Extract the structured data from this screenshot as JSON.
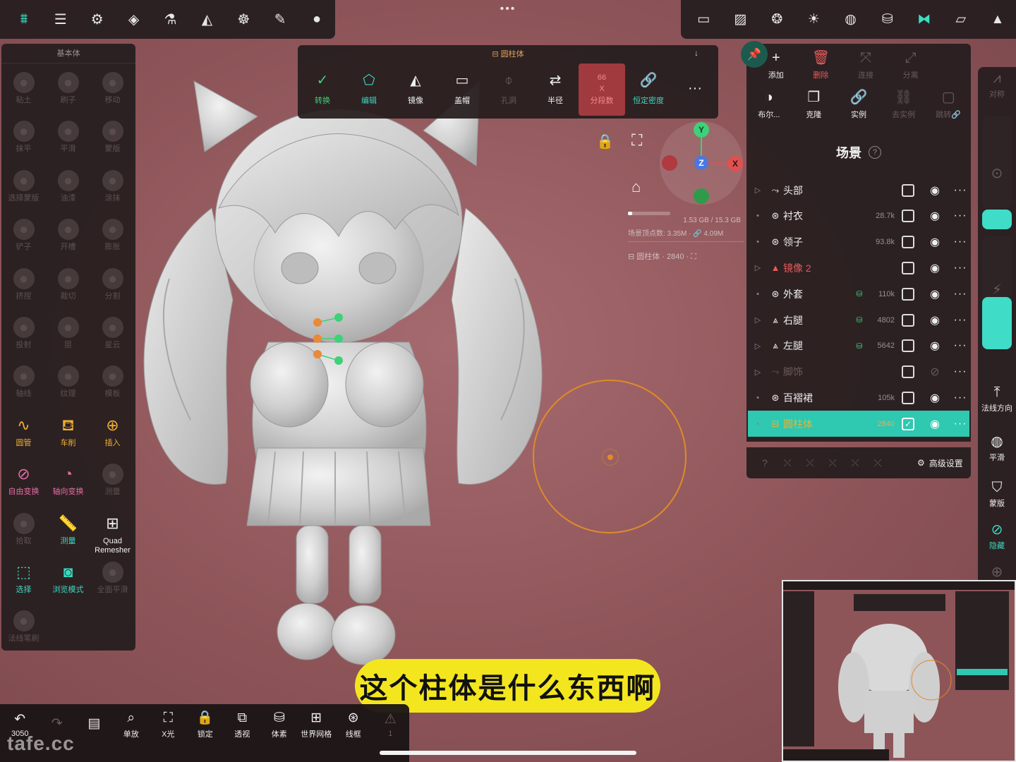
{
  "top_left_tools": [
    {
      "icon": "layers-stack-icon",
      "active": true
    },
    {
      "icon": "sliders-icon"
    },
    {
      "icon": "gear-icon"
    },
    {
      "icon": "stacked-layers-icon"
    },
    {
      "icon": "flask-icon"
    },
    {
      "icon": "symmetry-icon"
    },
    {
      "icon": "palette-icon"
    },
    {
      "icon": "pen-icon"
    },
    {
      "icon": "material-sphere-icon"
    }
  ],
  "top_right_tools": [
    {
      "icon": "camera-icon"
    },
    {
      "icon": "image-icon"
    },
    {
      "icon": "aperture-icon"
    },
    {
      "icon": "sun-icon"
    },
    {
      "icon": "globe-grid-icon"
    },
    {
      "icon": "cylinder-db-icon"
    },
    {
      "icon": "scene-graph-icon",
      "active": true
    },
    {
      "icon": "folder-icon"
    },
    {
      "icon": "nomad-logo-icon"
    }
  ],
  "top_dots": "•••",
  "left_panel": {
    "title": "基本体",
    "tools": [
      {
        "label": "粘土",
        "state": "dim",
        "icon": "clay-icon"
      },
      {
        "label": "刷子",
        "state": "dim",
        "icon": "brush-icon"
      },
      {
        "label": "移动",
        "state": "dim",
        "icon": "move-icon"
      },
      {
        "label": "抹平",
        "state": "dim",
        "icon": "flatten-icon"
      },
      {
        "label": "平滑",
        "state": "dim",
        "icon": "smooth-icon"
      },
      {
        "label": "蒙版",
        "state": "dim",
        "icon": "mask-icon"
      },
      {
        "label": "选择蒙版",
        "state": "dim",
        "icon": "select-mask-icon"
      },
      {
        "label": "油漆",
        "state": "dim",
        "icon": "paint-icon"
      },
      {
        "label": "涂抹",
        "state": "dim",
        "icon": "smudge-icon"
      },
      {
        "label": "铲子",
        "state": "dim",
        "icon": "scoop-icon"
      },
      {
        "label": "开槽",
        "state": "dim",
        "icon": "groove-icon"
      },
      {
        "label": "膨胀",
        "state": "dim",
        "icon": "inflate-icon"
      },
      {
        "label": "挤捏",
        "state": "dim",
        "icon": "pinch-icon"
      },
      {
        "label": "裁切",
        "state": "dim",
        "icon": "crop-icon"
      },
      {
        "label": "分割",
        "state": "dim",
        "icon": "split-icon"
      },
      {
        "label": "投射",
        "state": "dim",
        "icon": "project-icon"
      },
      {
        "label": "层",
        "state": "dim",
        "icon": "layer-icon"
      },
      {
        "label": "星云",
        "state": "dim",
        "icon": "nebula-icon"
      },
      {
        "label": "轴线",
        "state": "dim",
        "icon": "axis-icon"
      },
      {
        "label": "纹理",
        "state": "dim",
        "icon": "texture-icon"
      },
      {
        "label": "模板",
        "state": "dim",
        "icon": "stencil-icon"
      },
      {
        "label": "圆管",
        "state": "on",
        "color": "orange",
        "icon": "tube-curve-icon"
      },
      {
        "label": "车削",
        "state": "on",
        "color": "orange",
        "icon": "lathe-icon"
      },
      {
        "label": "插入",
        "state": "on",
        "color": "orange",
        "icon": "insert-icon"
      },
      {
        "label": "自由变换",
        "state": "on",
        "color": "pink",
        "icon": "free-transform-icon"
      },
      {
        "label": "轴向变换",
        "state": "on",
        "color": "pink",
        "icon": "axis-transform-icon"
      },
      {
        "label": "测量",
        "state": "dim",
        "icon": "measure-dim-icon"
      },
      {
        "label": "拾取",
        "state": "dim",
        "icon": "pick-icon"
      },
      {
        "label": "测量",
        "state": "on",
        "color": "teal",
        "icon": "ruler-icon"
      },
      {
        "label": "Quad Remesher",
        "state": "on",
        "color": "white",
        "icon": "grid-icon"
      },
      {
        "label": "选择",
        "state": "on",
        "color": "teal",
        "icon": "select-icon"
      },
      {
        "label": "浏览模式",
        "state": "on",
        "color": "teal",
        "icon": "camera-view-icon"
      },
      {
        "label": "全面平滑",
        "state": "dim",
        "icon": "full-smooth-icon"
      },
      {
        "label": "法线笔刷",
        "state": "dim",
        "icon": "normal-brush-icon"
      }
    ]
  },
  "cylinder_panel": {
    "title": "⊟ 圆柱体",
    "arrow": "↓",
    "tools": [
      {
        "label": "转换",
        "icon": "check-circle-icon",
        "color": "green",
        "glyph": "✓"
      },
      {
        "label": "编辑",
        "icon": "edit-shape-icon",
        "color": "teal",
        "glyph": "⬠"
      },
      {
        "label": "镜像",
        "icon": "mirror-icon",
        "color": "white",
        "glyph": "◭"
      },
      {
        "label": "盖帽",
        "icon": "cap-icon",
        "color": "white",
        "glyph": "▭"
      },
      {
        "label": "孔洞",
        "icon": "hole-icon",
        "color": "dim",
        "glyph": "⌽"
      },
      {
        "label": "半径",
        "icon": "radius-icon",
        "color": "white",
        "glyph": "⇄"
      },
      {
        "label": "分段数",
        "icon": "segments-icon",
        "color": "red",
        "value_a": "66",
        "value_b": "X"
      },
      {
        "label": "恒定密度",
        "icon": "link-icon",
        "color": "teal",
        "glyph": "🔗"
      },
      {
        "label": "",
        "icon": "more-icon",
        "color": "white",
        "glyph": "···"
      }
    ]
  },
  "viewport": {
    "memory": "1.53 GB / 15.3 GB",
    "scene_vertices": "场景顶点数: 3.35M · 🔗 4.09M",
    "object_info": "⊟ 圆柱体 · 2840 · ⛶",
    "gizmo": {
      "y": "Y",
      "z": "Z",
      "x": "X"
    }
  },
  "scene_actions": {
    "row1": [
      {
        "label": "添加",
        "icon": "plus-icon",
        "glyph": "+"
      },
      {
        "label": "删除",
        "icon": "trash-icon",
        "glyph": "🗑",
        "color": "red"
      },
      {
        "label": "连接",
        "icon": "join-icon",
        "glyph": "⤧",
        "color": "dim"
      },
      {
        "label": "分离",
        "icon": "separate-icon",
        "glyph": "⤢",
        "color": "dim"
      }
    ],
    "row2": [
      {
        "label": "布尔...",
        "icon": "boolean-icon",
        "glyph": "◑"
      },
      {
        "label": "克隆",
        "icon": "clone-icon",
        "glyph": "❐"
      },
      {
        "label": "实例",
        "icon": "instance-link-icon",
        "glyph": "🔗"
      },
      {
        "label": "去实例",
        "icon": "uninstance-icon",
        "glyph": "⛓",
        "color": "dim"
      },
      {
        "label": "跳转🔗",
        "icon": "jump-icon",
        "glyph": "▢",
        "color": "dim"
      }
    ]
  },
  "scene": {
    "title": "场景",
    "help": "?",
    "items": [
      {
        "name": "头部",
        "type": "group",
        "expand": "▷",
        "type_glyph": "⤳",
        "count": "",
        "locked": false,
        "checked": false,
        "visible": true
      },
      {
        "name": "衬衣",
        "type": "mesh",
        "expand": "•",
        "type_glyph": "⊛",
        "count": "28.7k",
        "locked": false,
        "checked": false,
        "visible": true
      },
      {
        "name": "领子",
        "type": "mesh",
        "expand": "•",
        "type_glyph": "⊛",
        "count": "93.8k",
        "locked": false,
        "checked": false,
        "visible": true
      },
      {
        "name": "镜像 2",
        "type": "mirror",
        "expand": "▷",
        "type_glyph": "▲",
        "count": "",
        "locked": false,
        "checked": false,
        "visible": true,
        "color": "red"
      },
      {
        "name": "外套",
        "type": "mesh",
        "expand": "•",
        "type_glyph": "⊛",
        "count": "110k",
        "locked": true,
        "checked": false,
        "visible": true
      },
      {
        "name": "右腿",
        "type": "mesh-group",
        "expand": "▷",
        "type_glyph": "⩓",
        "count": "4802",
        "locked": true,
        "checked": false,
        "visible": true
      },
      {
        "name": "左腿",
        "type": "mesh-group",
        "expand": "▷",
        "type_glyph": "⩓",
        "count": "5642",
        "locked": true,
        "checked": false,
        "visible": true
      },
      {
        "name": "脚饰",
        "type": "group",
        "expand": "▷",
        "type_glyph": "⤳",
        "count": "",
        "locked": false,
        "checked": false,
        "visible": false,
        "color": "dim"
      },
      {
        "name": "百褶裙",
        "type": "mesh",
        "expand": "•",
        "type_glyph": "⊛",
        "count": "105k",
        "locked": false,
        "checked": false,
        "visible": true
      },
      {
        "name": "圆柱体",
        "type": "cylinder",
        "expand": "•",
        "type_glyph": "⊟",
        "count": "2840",
        "locked": false,
        "checked": true,
        "visible": true,
        "selected": true
      }
    ],
    "footer_advanced": "高级设置"
  },
  "right_panel": [
    {
      "label": "对称",
      "icon": "symmetry-side-icon",
      "glyph": "⩘",
      "color": "dim"
    },
    {
      "label": "",
      "icon": "target-icon",
      "glyph": "⊙",
      "color": "dim"
    },
    {
      "label": "",
      "icon": "bolt-icon",
      "glyph": "⚡",
      "color": "dim"
    },
    {
      "label": "法线方向",
      "icon": "upload-icon",
      "glyph": "⤒"
    },
    {
      "label": "平滑",
      "icon": "smooth-sphere-icon",
      "glyph": "◍"
    },
    {
      "label": "蒙版",
      "icon": "mask-shield-icon",
      "glyph": "⛉"
    },
    {
      "label": "隐藏",
      "icon": "hide-icon",
      "glyph": "⊘",
      "color": "teal"
    },
    {
      "label": "",
      "icon": "axis-gizmo-icon",
      "glyph": "⊕",
      "color": "dim"
    }
  ],
  "subtitle": "这个柱体是什么东西啊",
  "bottom_tools": [
    {
      "label": "3050",
      "icon": "undo-icon",
      "glyph": "↶"
    },
    {
      "label": "",
      "icon": "redo-icon",
      "glyph": "↷",
      "color": "dim"
    },
    {
      "label": "",
      "icon": "document-icon",
      "glyph": "▤"
    },
    {
      "label": "单放",
      "icon": "search-icon",
      "glyph": "⌕"
    },
    {
      "label": "X光",
      "icon": "xray-icon",
      "glyph": "⛶"
    },
    {
      "label": "锁定",
      "icon": "lock-icon",
      "glyph": "🔒"
    },
    {
      "label": "透视",
      "icon": "perspective-icon",
      "glyph": "⧉"
    },
    {
      "label": "体素",
      "icon": "voxel-icon",
      "glyph": "⛁"
    },
    {
      "label": "世界网格",
      "icon": "world-grid-icon",
      "glyph": "⊞"
    },
    {
      "label": "线框",
      "icon": "wireframe-icon",
      "glyph": "⊛"
    },
    {
      "label": "1",
      "icon": "warning-icon",
      "glyph": "⚠",
      "color": "dim"
    }
  ],
  "watermark": "tafe.cc"
}
